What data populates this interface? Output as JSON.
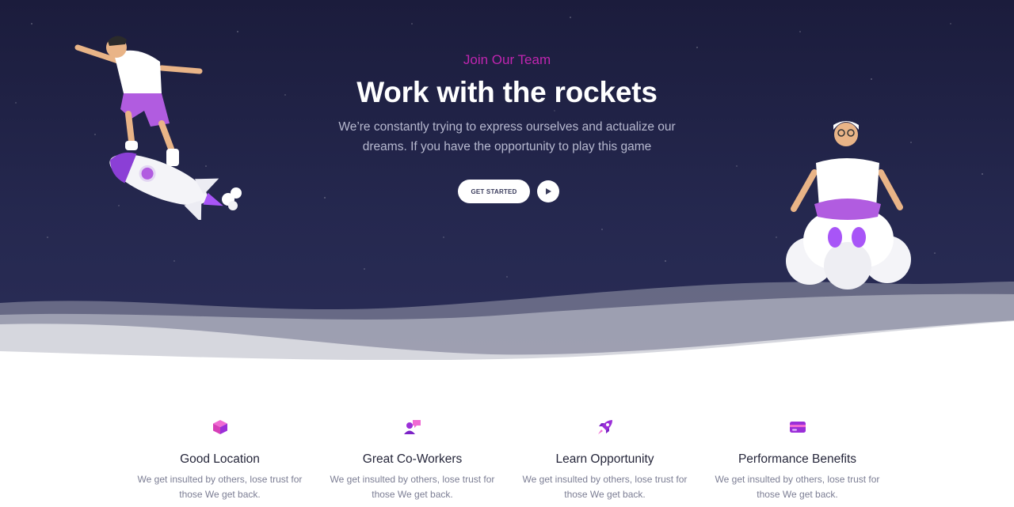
{
  "hero": {
    "eyebrow": "Join Our Team",
    "title": "Work with the rockets",
    "subtitle": "We’re constantly trying to express ourselves and actualize our dreams. If you have the opportunity to play this game",
    "cta_label": "GET STARTED",
    "play_icon": "play-icon",
    "colors": {
      "background": "#1f2147",
      "eyebrow": "#c025b0",
      "accent": "#a855f7"
    }
  },
  "features": [
    {
      "icon": "cube-icon",
      "title": "Good Location",
      "text": "We get insulted by others, lose trust for those We get back."
    },
    {
      "icon": "user-chat-icon",
      "title": "Great Co-Workers",
      "text": "We get insulted by others, lose trust for those We get back."
    },
    {
      "icon": "rocket-icon",
      "title": "Learn Opportunity",
      "text": "We get insulted by others, lose trust for those We get back."
    },
    {
      "icon": "credit-card-icon",
      "title": "Performance Benefits",
      "text": "We get insulted by others, lose trust for those We get back."
    }
  ]
}
